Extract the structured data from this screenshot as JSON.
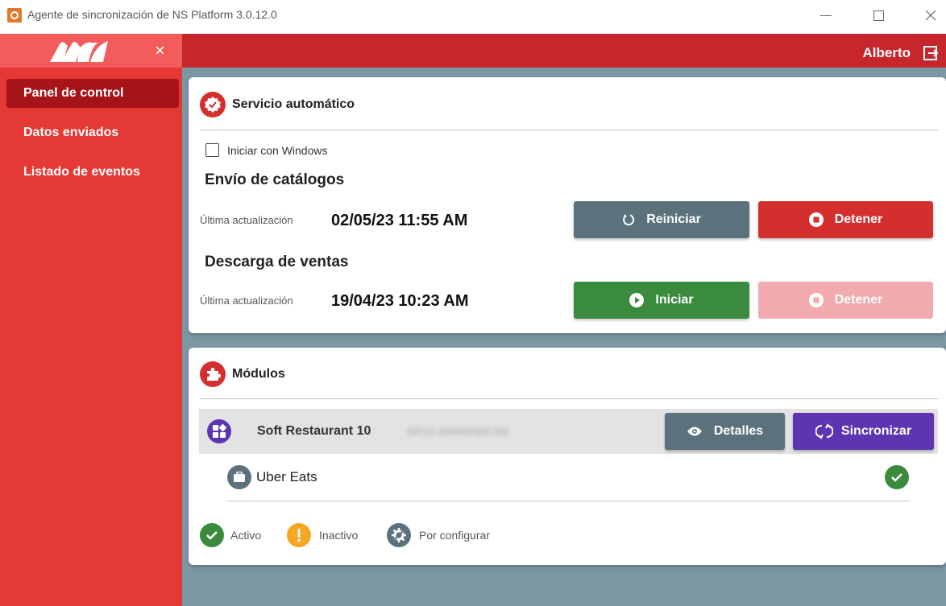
{
  "window": {
    "title": "Agente de sincronización de NS Platform 3.0.12.0"
  },
  "header": {
    "close_menu": "×",
    "user": "Alberto"
  },
  "sidebar": {
    "items": [
      {
        "label": "Panel de control",
        "active": true
      },
      {
        "label": "Datos enviados",
        "active": false
      },
      {
        "label": "Listado de eventos",
        "active": false
      }
    ]
  },
  "service": {
    "title": "Servicio automático",
    "start_with_windows": {
      "label": "Iniciar con Windows",
      "checked": false
    },
    "catalogs": {
      "title": "Envío de catálogos",
      "last_label": "Última actualización",
      "last_value": "02/05/23 11:55 AM",
      "restart_label": "Reiniciar",
      "stop_label": "Detener"
    },
    "sales": {
      "title": "Descarga de ventas",
      "last_label": "Última actualización",
      "last_value": "19/04/23 10:23 AM",
      "start_label": "Iniciar",
      "stop_label": "Detener",
      "stop_disabled": true
    }
  },
  "modules": {
    "title": "Módulos",
    "items": [
      {
        "name": "Soft Restaurant 10",
        "serial": "SR10.004MIN65782",
        "details_label": "Detalles",
        "sync_label": "Sincronizar",
        "sub_items": [
          {
            "name": "Uber Eats",
            "status": "active"
          }
        ]
      }
    ],
    "legend": {
      "active": "Activo",
      "inactive": "Inactivo",
      "to_configure": "Por configurar"
    }
  },
  "colors": {
    "brand_red": "#c8262d",
    "sidebar_red": "#e53935",
    "active_item": "#a41418",
    "gray_button": "#5b717c",
    "green": "#3a8b3e",
    "purple": "#5e35b1",
    "orange": "#f5a623",
    "background": "#7b97a4"
  }
}
